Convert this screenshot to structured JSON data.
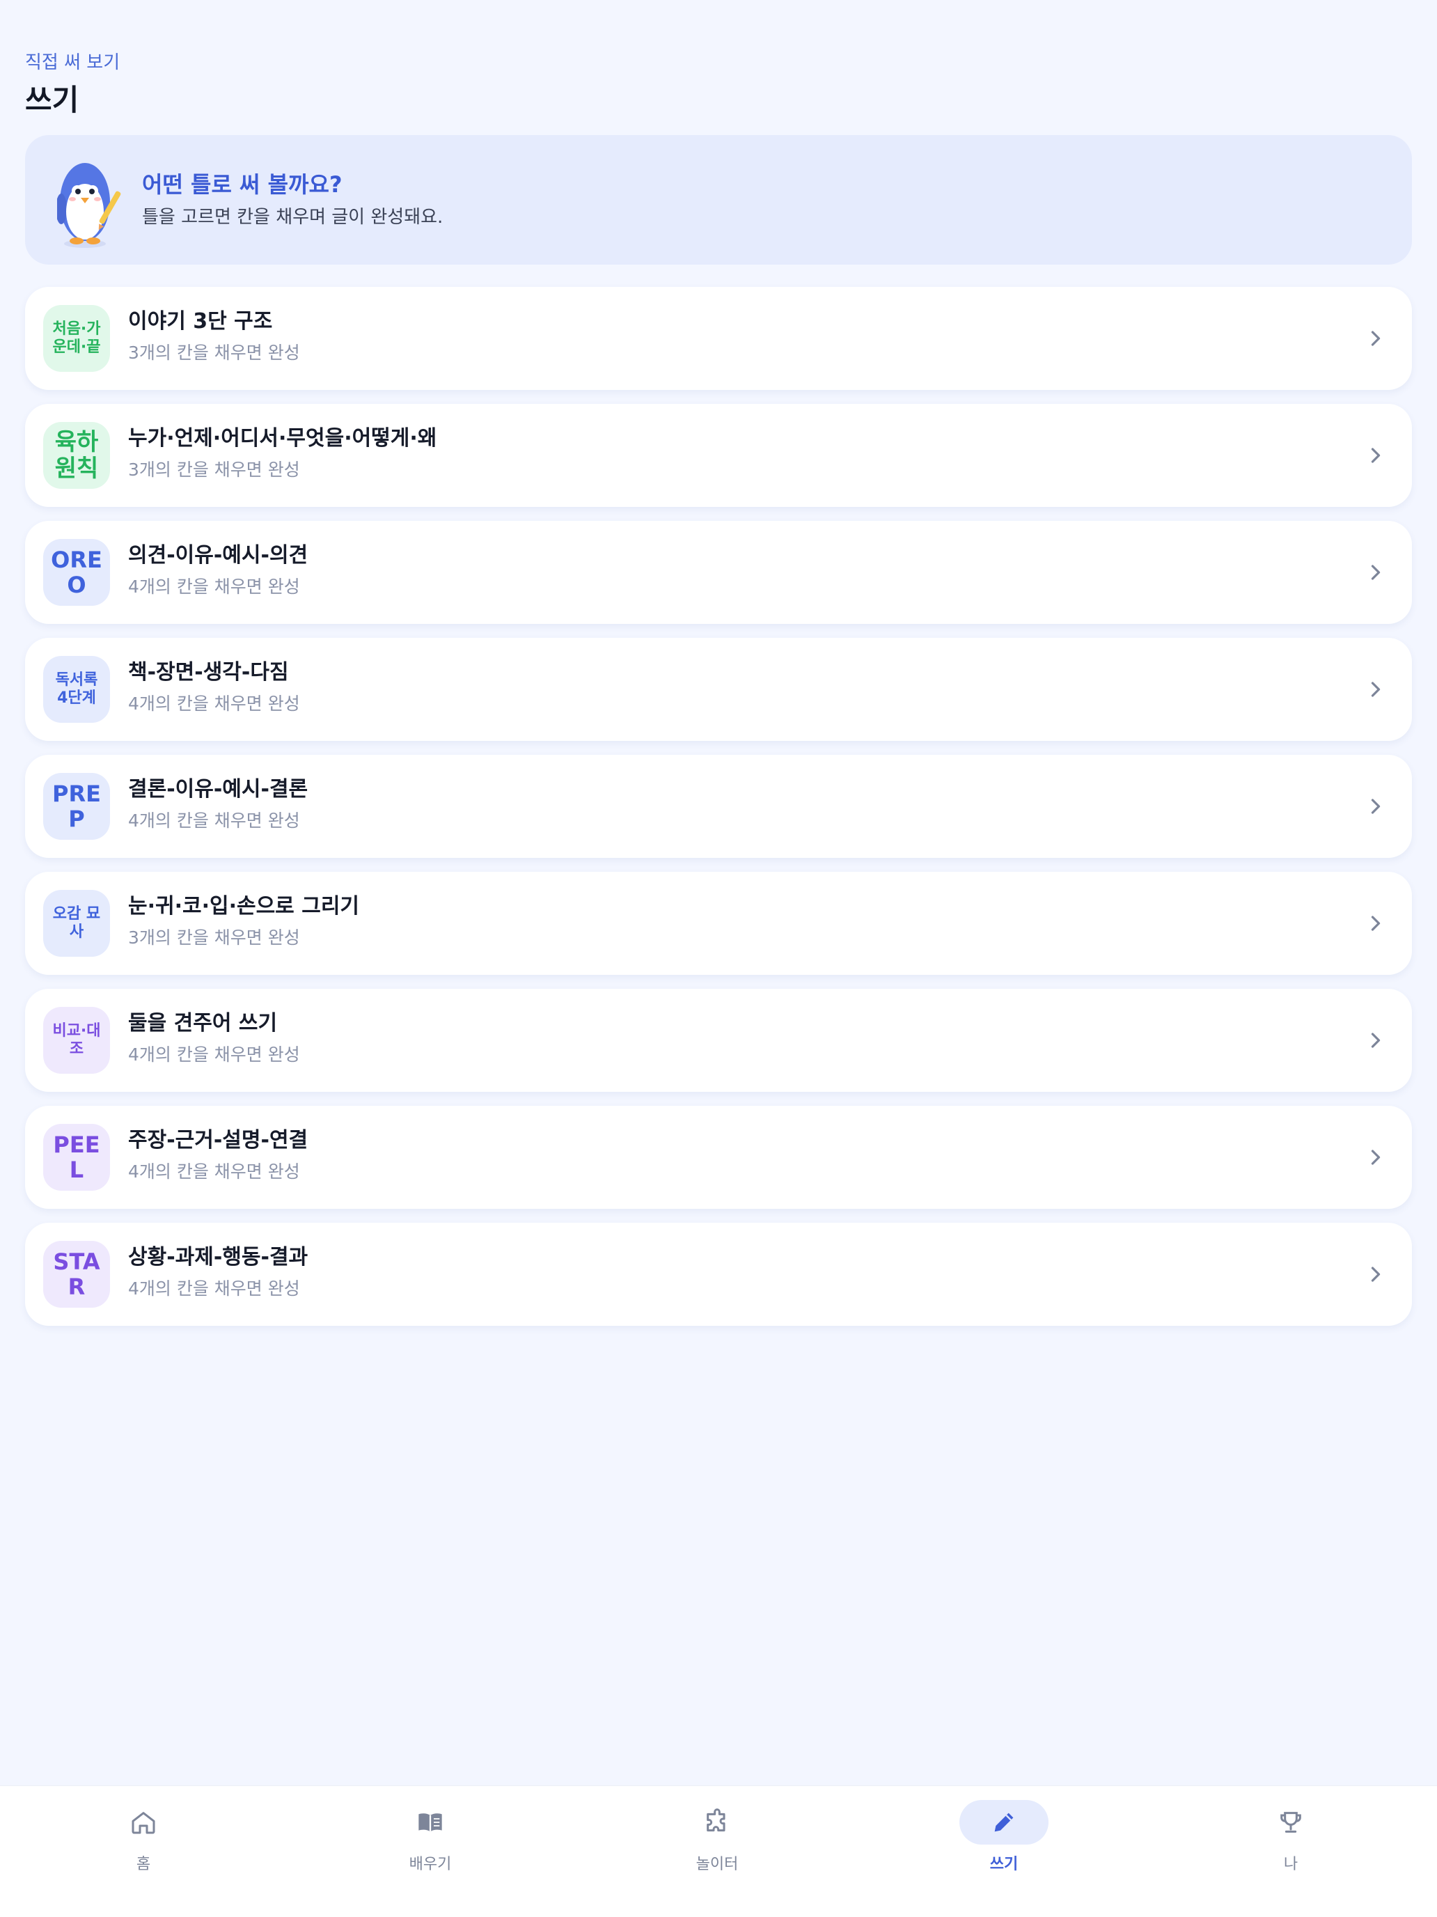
{
  "header": {
    "subtitle": "직접 써 보기",
    "title": "쓰기"
  },
  "intro": {
    "title": "어떤 틀로 써 볼까요?",
    "description": "틀을 고르면 칸을 채우며 글이 완성돼요."
  },
  "templates": [
    {
      "badge_line1": "처음·가",
      "badge_line2": "운데·끝",
      "badge_color": "green",
      "title": "이야기 3단 구조",
      "description": "3개의 칸을 채우면 완성"
    },
    {
      "badge_line1": "육하",
      "badge_line2": "원칙",
      "badge_color": "green",
      "title": "누가·언제·어디서·무엇을·어떻게·왜",
      "description": "3개의 칸을 채우면 완성"
    },
    {
      "badge_line1": "ORE",
      "badge_line2": "O",
      "badge_color": "blue",
      "title": "의견-이유-예시-의견",
      "description": "4개의 칸을 채우면 완성"
    },
    {
      "badge_line1": "독서록",
      "badge_line2": "4단계",
      "badge_color": "blue",
      "title": "책-장면-생각-다짐",
      "description": "4개의 칸을 채우면 완성"
    },
    {
      "badge_line1": "PRE",
      "badge_line2": "P",
      "badge_color": "blue",
      "title": "결론-이유-예시-결론",
      "description": "4개의 칸을 채우면 완성"
    },
    {
      "badge_line1": "오감 묘",
      "badge_line2": "사",
      "badge_color": "blue",
      "title": "눈·귀·코·입·손으로 그리기",
      "description": "3개의 칸을 채우면 완성"
    },
    {
      "badge_line1": "비교·대",
      "badge_line2": "조",
      "badge_color": "purple",
      "title": "둘을 견주어 쓰기",
      "description": "4개의 칸을 채우면 완성"
    },
    {
      "badge_line1": "PEE",
      "badge_line2": "L",
      "badge_color": "purple",
      "title": "주장-근거-설명-연결",
      "description": "4개의 칸을 채우면 완성"
    },
    {
      "badge_line1": "STA",
      "badge_line2": "R",
      "badge_color": "purple",
      "title": "상황-과제-행동-결과",
      "description": "4개의 칸을 채우면 완성"
    }
  ],
  "tabs": [
    {
      "label": "홈",
      "icon": "home-icon",
      "active": false
    },
    {
      "label": "배우기",
      "icon": "book-icon",
      "active": false
    },
    {
      "label": "놀이터",
      "icon": "puzzle-icon",
      "active": false
    },
    {
      "label": "쓰기",
      "icon": "pencil-icon",
      "active": true
    },
    {
      "label": "나",
      "icon": "trophy-icon",
      "active": false
    }
  ],
  "colors": {
    "accent": "#3f5fd8",
    "background": "#f3f6ff",
    "badge_green": "#25b35c",
    "badge_blue": "#3f62dc",
    "badge_purple": "#7a4ee0"
  }
}
